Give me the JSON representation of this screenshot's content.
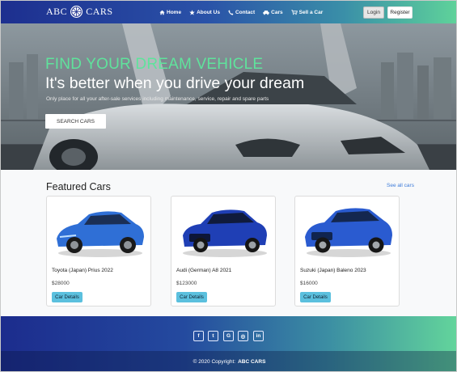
{
  "navbar": {
    "brand_left": "ABC",
    "brand_right": "CARS",
    "links": [
      {
        "label": "Home",
        "icon": "home-icon"
      },
      {
        "label": "About Us",
        "icon": "star-icon"
      },
      {
        "label": "Contact",
        "icon": "phone-icon"
      },
      {
        "label": "Cars",
        "icon": "car-icon"
      },
      {
        "label": "Sell a Car",
        "icon": "cart-icon"
      }
    ],
    "login_label": "Login",
    "register_label": "Register"
  },
  "hero": {
    "title": "FIND YOUR DREAM VEHICLE",
    "subtitle": "It's better when you drive your dream",
    "text": "Only place for all your after-sale services including maintenance, service, repair and spare parts",
    "button_label": "SEARCH CARS"
  },
  "featured": {
    "title": "Featured Cars",
    "see_all": "See all cars",
    "cars": [
      {
        "name": "Toyota (Japan) Prius 2022",
        "price": "$28000",
        "button_label": "Car Details"
      },
      {
        "name": "Audi (German) A8 2021",
        "price": "$123000",
        "button_label": "Car Details"
      },
      {
        "name": "Suzuki (Japan) Baleno 2023",
        "price": "$16000",
        "button_label": "Car Details"
      }
    ]
  },
  "footer": {
    "social": [
      {
        "glyph": "f",
        "icon": "facebook-icon"
      },
      {
        "glyph": "t",
        "icon": "twitter-icon"
      },
      {
        "glyph": "G",
        "icon": "google-icon"
      },
      {
        "glyph": "◎",
        "icon": "instagram-icon"
      },
      {
        "glyph": "in",
        "icon": "linkedin-icon"
      }
    ],
    "copyright_text": "© 2020 Copyright:",
    "copyright_brand": "ABC CARS"
  },
  "colors": {
    "accent_green": "#5fe39c",
    "navy": "#1d2f8f",
    "info_button": "#5bc0de",
    "link_blue": "#3d7bd9"
  }
}
